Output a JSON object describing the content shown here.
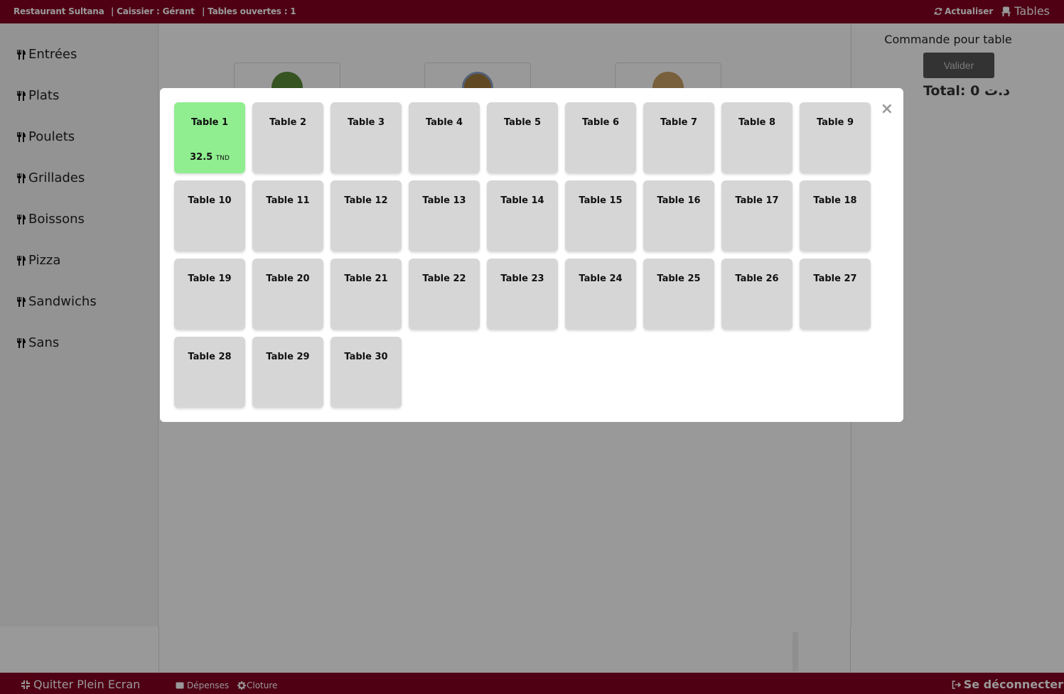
{
  "topbar": {
    "restaurant": "Restaurant Sultana",
    "cashier_label": "| Caissier :",
    "cashier_name": "Gérant",
    "tables_open": "| Tables ouvertes : 1",
    "refresh_label": "Actualiser",
    "tables_label": "Tables"
  },
  "sidebar": {
    "categories": [
      "Entrées",
      "Plats",
      "Poulets",
      "Grillades",
      "Boissons",
      "Pizza",
      "Sandwichs",
      "Sans"
    ]
  },
  "order_panel": {
    "title": "Commande pour table",
    "validate_label": "Valider",
    "total_label": "Total: 0 د.ت"
  },
  "bottombar": {
    "exit_fullscreen": "Quitter Plein Ecran",
    "expenses": "Dépenses",
    "closing": "Cloture",
    "logout": "Se déconnecter"
  },
  "modal": {
    "close_symbol": "×",
    "tables": [
      {
        "name": "Table 1",
        "amount": "32.5",
        "currency": "TND",
        "open": true
      },
      {
        "name": "Table 2"
      },
      {
        "name": "Table 3"
      },
      {
        "name": "Table 4"
      },
      {
        "name": "Table 5"
      },
      {
        "name": "Table 6"
      },
      {
        "name": "Table 7"
      },
      {
        "name": "Table 8"
      },
      {
        "name": "Table 9"
      },
      {
        "name": "Table 10"
      },
      {
        "name": "Table 11"
      },
      {
        "name": "Table 12"
      },
      {
        "name": "Table 13"
      },
      {
        "name": "Table 14"
      },
      {
        "name": "Table 15"
      },
      {
        "name": "Table 16"
      },
      {
        "name": "Table 17"
      },
      {
        "name": "Table 18"
      },
      {
        "name": "Table 19"
      },
      {
        "name": "Table 20"
      },
      {
        "name": "Table 21"
      },
      {
        "name": "Table 22"
      },
      {
        "name": "Table 23"
      },
      {
        "name": "Table 24"
      },
      {
        "name": "Table 25"
      },
      {
        "name": "Table 26"
      },
      {
        "name": "Table 27"
      },
      {
        "name": "Table 28"
      },
      {
        "name": "Table 29"
      },
      {
        "name": "Table 30"
      }
    ]
  },
  "colors": {
    "brand": "#840020",
    "open_table": "#90ee90",
    "table": "#d6d6d6"
  }
}
